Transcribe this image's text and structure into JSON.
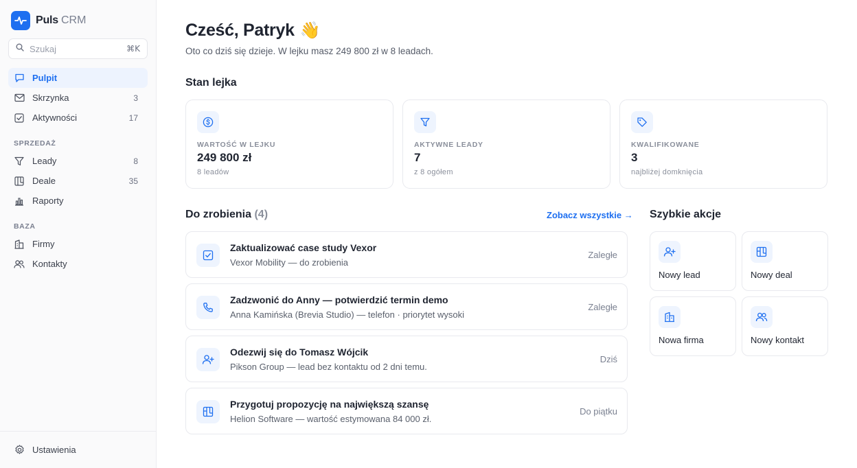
{
  "brand": {
    "name": "Puls",
    "sub": "CRM"
  },
  "search": {
    "placeholder": "Szukaj",
    "shortcut": "⌘K"
  },
  "nav": {
    "main": [
      {
        "label": "Pulpit",
        "count": ""
      },
      {
        "label": "Skrzynka",
        "count": "3"
      },
      {
        "label": "Aktywności",
        "count": "17"
      }
    ],
    "sales_title": "SPRZEDAŻ",
    "sales": [
      {
        "label": "Leady",
        "count": "8"
      },
      {
        "label": "Deale",
        "count": "35"
      },
      {
        "label": "Raporty",
        "count": ""
      }
    ],
    "base_title": "BAZA",
    "base": [
      {
        "label": "Firmy"
      },
      {
        "label": "Kontakty"
      }
    ],
    "settings": "Ustawienia"
  },
  "header": {
    "greeting": "Cześć, Patryk",
    "wave": "👋",
    "subtitle": "Oto co dziś się dzieje. W lejku masz 249 800 zł w 8 leadach."
  },
  "pipeline": {
    "title": "Stan lejka",
    "cards": [
      {
        "label": "WARTOŚĆ W LEJKU",
        "value": "249 800 zł",
        "note": "8 leadów",
        "icon": "dollar-icon"
      },
      {
        "label": "AKTYWNE LEADY",
        "value": "7",
        "note": "z 8 ogółem",
        "icon": "funnel-icon"
      },
      {
        "label": "KWALIFIKOWANE",
        "value": "3",
        "note": "najbliżej domknięcia",
        "icon": "tag-icon"
      }
    ]
  },
  "todo": {
    "title": "Do zrobienia",
    "count": "(4)",
    "see_all": "Zobacz wszystkie →",
    "items": [
      {
        "title": "Zaktualizować case study Vexor",
        "sub": "Vexor Mobility — do zrobienia",
        "due": "Zaległe",
        "icon": "checkbox-icon"
      },
      {
        "title": "Zadzwonić do Anny — potwierdzić termin demo",
        "sub": "Anna Kamińska (Brevia Studio) — telefon · priorytet wysoki",
        "due": "Zaległe",
        "icon": "phone-icon"
      },
      {
        "title": "Odezwij się do Tomasz Wójcik",
        "sub": "Pikson Group — lead bez kontaktu od 2 dni temu.",
        "due": "Dziś",
        "icon": "user-plus-icon"
      },
      {
        "title": "Przygotuj propozycję na największą szansę",
        "sub": "Helion Software — wartość estymowana 84 000 zł.",
        "due": "Do piątku",
        "icon": "kanban-icon"
      }
    ]
  },
  "quick": {
    "title": "Szybkie akcje",
    "actions": [
      {
        "label": "Nowy lead",
        "icon": "user-plus-icon"
      },
      {
        "label": "Nowy deal",
        "icon": "kanban-icon"
      },
      {
        "label": "Nowa firma",
        "icon": "building-icon"
      },
      {
        "label": "Nowy kontakt",
        "icon": "users-icon"
      }
    ]
  },
  "colors": {
    "accent": "#1e6ff0",
    "accent_soft": "#eef4fe",
    "border": "#e8e9ee"
  }
}
